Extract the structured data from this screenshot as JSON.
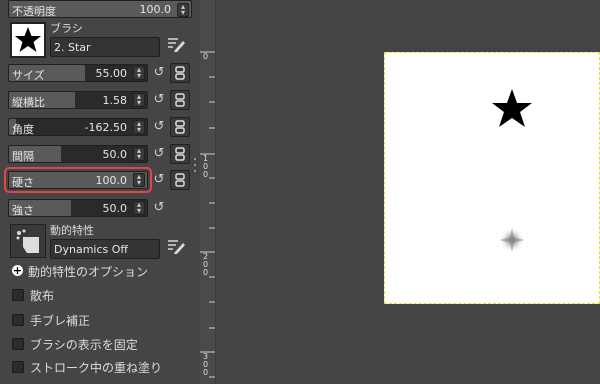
{
  "opacity": {
    "label": "不透明度",
    "value": "100.0"
  },
  "brush": {
    "section_label": "ブラシ",
    "name": "2. Star"
  },
  "sliders": [
    {
      "label": "サイズ",
      "value": "55.00",
      "fill": 0.55,
      "has_chain": true
    },
    {
      "label": "縦横比",
      "value": "1.58",
      "fill": 0.48,
      "has_chain": true
    },
    {
      "label": "角度",
      "value": "-162.50",
      "fill": 0.05,
      "has_chain": true
    },
    {
      "label": "間隔",
      "value": "50.0",
      "fill": 0.38,
      "has_chain": true
    },
    {
      "label": "硬さ",
      "value": "100.0",
      "fill": 1.0,
      "has_chain": true,
      "highlighted": true
    },
    {
      "label": "強さ",
      "value": "50.0",
      "fill": 0.45,
      "has_chain": false
    }
  ],
  "dynamics": {
    "section_label": "動的特性",
    "name": "Dynamics Off"
  },
  "dynamics_options_label": "動的特性のオプション",
  "options": [
    {
      "label": "散布"
    },
    {
      "label": "手ブレ補正"
    },
    {
      "label": "ブラシの表示を固定"
    },
    {
      "label": "ストローク中の重ね塗り"
    }
  ],
  "ruler": {
    "ticks": [
      "0",
      "100",
      "200",
      "300"
    ]
  },
  "colors": {
    "highlight": "#e0454f",
    "selection": "#e9d835",
    "canvas_bg": "#ffffff"
  }
}
